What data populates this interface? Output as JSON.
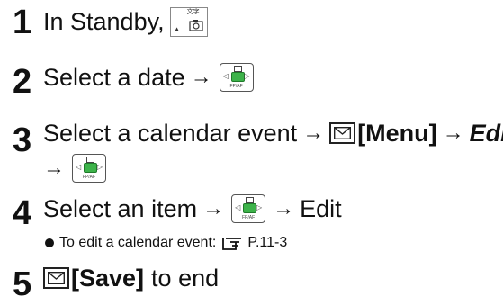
{
  "steps": [
    {
      "number": "1",
      "text_before": "In Standby,",
      "icon": "standby-key-icon"
    },
    {
      "number": "2",
      "text_before": "Select a date",
      "arrow": "→",
      "icon": "center-key-icon"
    },
    {
      "number": "3",
      "text_before": "Select a calendar event",
      "arrow": "→",
      "menu_label": "[Menu]",
      "arrow2": "→",
      "edit_label": "Edit",
      "icon_second_line": "center-key-icon"
    },
    {
      "number": "4",
      "text_before": "Select an item",
      "arrow": "→",
      "arrow2": "→",
      "text_after": "Edit",
      "note": "To edit a calendar event:",
      "note_ref": "P.11-3"
    },
    {
      "number": "5",
      "save_label": "[Save]",
      "text_after": "to end"
    }
  ],
  "icons": {
    "standby_key_text": "文字",
    "center_key_label": "FP/AF"
  },
  "colors": {
    "green_key": "#3db34a"
  }
}
